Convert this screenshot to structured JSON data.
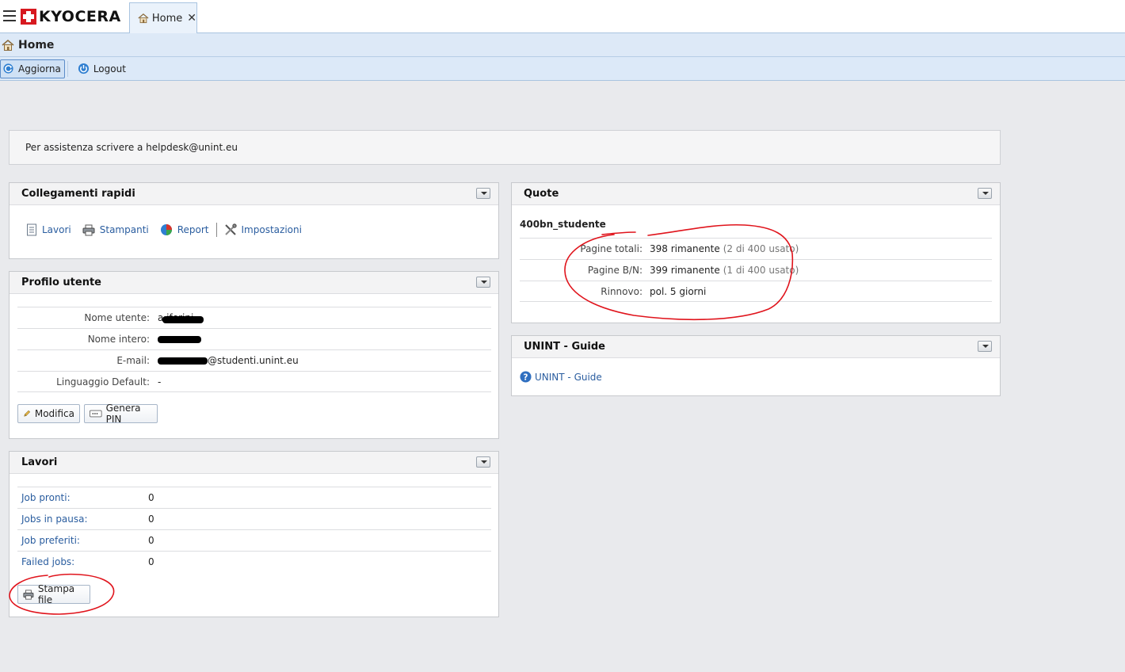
{
  "app": {
    "logo_text": "KYOCERA",
    "tab_label": "Home"
  },
  "page": {
    "title": "Home"
  },
  "toolbar": {
    "refresh_label": "Aggiorna",
    "logout_label": "Logout"
  },
  "notice": "Per assistenza scrivere a helpdesk@unint.eu",
  "quick_links": {
    "title": "Collegamenti rapidi",
    "items": [
      "Lavori",
      "Stampanti",
      "Report",
      "Impostazioni"
    ]
  },
  "profile": {
    "title": "Profilo utente",
    "rows": [
      {
        "label": "Nome utente:",
        "value": "a        iferini"
      },
      {
        "label": "Nome intero:",
        "value": ""
      },
      {
        "label": "E-mail:",
        "value": "@studenti.unint.eu"
      },
      {
        "label": "Linguaggio Default:",
        "value": "-"
      }
    ],
    "edit_label": "Modifica",
    "pin_label": "Genera PIN"
  },
  "jobs": {
    "title": "Lavori",
    "rows": [
      {
        "label": "Job pronti:",
        "value": "0"
      },
      {
        "label": "Jobs in pausa:",
        "value": "0"
      },
      {
        "label": "Job preferiti:",
        "value": "0"
      },
      {
        "label": "Failed jobs:",
        "value": "0"
      }
    ],
    "print_label": "Stampa file"
  },
  "quote": {
    "title": "Quote",
    "profile_name": "400bn_studente",
    "rows": [
      {
        "label": "Pagine totali:",
        "value": "398 rimanente",
        "detail": "(2 di 400 usato)"
      },
      {
        "label": "Pagine B/N:",
        "value": "399 rimanente",
        "detail": "(1 di 400 usato)"
      },
      {
        "label": "Rinnovo:",
        "value": "pol. 5 giorni",
        "detail": ""
      }
    ]
  },
  "guide": {
    "title": "UNINT - Guide",
    "link_label": "UNINT - Guide"
  },
  "colors": {
    "brand_red": "#d71920",
    "link_blue": "#2a5d9f",
    "annotation_red": "#e0141c"
  },
  "icons": [
    "menu-icon",
    "home-icon",
    "refresh-icon",
    "power-icon",
    "document-icon",
    "printer-icon",
    "pie-chart-icon",
    "tools-icon",
    "pencil-icon",
    "keypad-icon",
    "help-icon",
    "chevron-down-icon",
    "close-icon"
  ]
}
